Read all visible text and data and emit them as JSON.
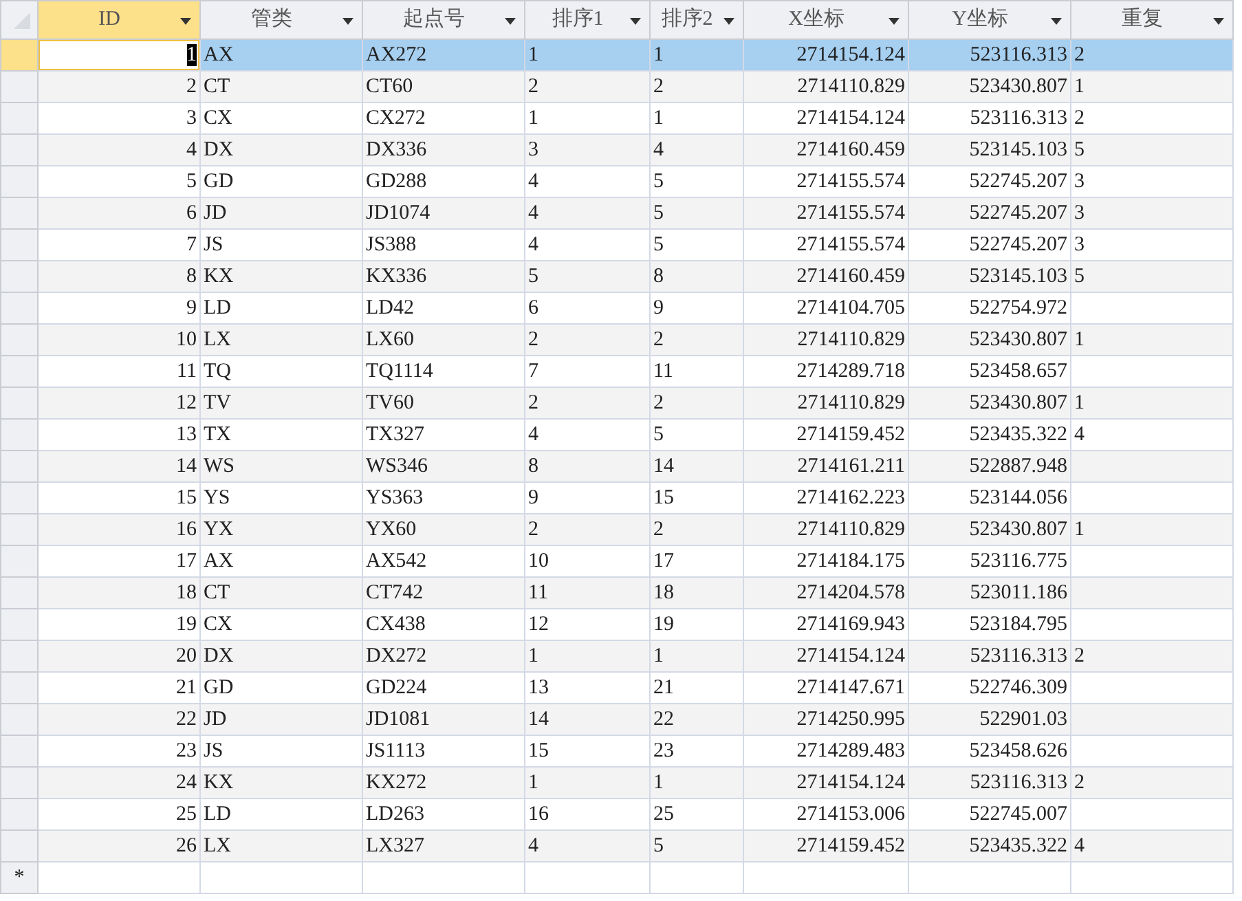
{
  "columns": [
    {
      "label": "ID",
      "selected": true
    },
    {
      "label": "管类",
      "selected": false
    },
    {
      "label": "起点号",
      "selected": false
    },
    {
      "label": "排序1",
      "selected": false
    },
    {
      "label": "排序2",
      "selected": false
    },
    {
      "label": "X坐标",
      "selected": false
    },
    {
      "label": "Y坐标",
      "selected": false
    },
    {
      "label": "重复",
      "selected": false
    }
  ],
  "rows": [
    {
      "selected": true,
      "cells": [
        "1",
        "AX",
        "AX272",
        "1",
        "1",
        "2714154.124",
        "523116.313",
        "2"
      ]
    },
    {
      "selected": false,
      "cells": [
        "2",
        "CT",
        "CT60",
        "2",
        "2",
        "2714110.829",
        "523430.807",
        "1"
      ]
    },
    {
      "selected": false,
      "cells": [
        "3",
        "CX",
        "CX272",
        "1",
        "1",
        "2714154.124",
        "523116.313",
        "2"
      ]
    },
    {
      "selected": false,
      "cells": [
        "4",
        "DX",
        "DX336",
        "3",
        "4",
        "2714160.459",
        "523145.103",
        "5"
      ]
    },
    {
      "selected": false,
      "cells": [
        "5",
        "GD",
        "GD288",
        "4",
        "5",
        "2714155.574",
        "522745.207",
        "3"
      ]
    },
    {
      "selected": false,
      "cells": [
        "6",
        "JD",
        "JD1074",
        "4",
        "5",
        "2714155.574",
        "522745.207",
        "3"
      ]
    },
    {
      "selected": false,
      "cells": [
        "7",
        "JS",
        "JS388",
        "4",
        "5",
        "2714155.574",
        "522745.207",
        "3"
      ]
    },
    {
      "selected": false,
      "cells": [
        "8",
        "KX",
        "KX336",
        "5",
        "8",
        "2714160.459",
        "523145.103",
        "5"
      ]
    },
    {
      "selected": false,
      "cells": [
        "9",
        "LD",
        "LD42",
        "6",
        "9",
        "2714104.705",
        "522754.972",
        ""
      ]
    },
    {
      "selected": false,
      "cells": [
        "10",
        "LX",
        "LX60",
        "2",
        "2",
        "2714110.829",
        "523430.807",
        "1"
      ]
    },
    {
      "selected": false,
      "cells": [
        "11",
        "TQ",
        "TQ1114",
        "7",
        "11",
        "2714289.718",
        "523458.657",
        ""
      ]
    },
    {
      "selected": false,
      "cells": [
        "12",
        "TV",
        "TV60",
        "2",
        "2",
        "2714110.829",
        "523430.807",
        "1"
      ]
    },
    {
      "selected": false,
      "cells": [
        "13",
        "TX",
        "TX327",
        "4",
        "5",
        "2714159.452",
        "523435.322",
        "4"
      ]
    },
    {
      "selected": false,
      "cells": [
        "14",
        "WS",
        "WS346",
        "8",
        "14",
        "2714161.211",
        "522887.948",
        ""
      ]
    },
    {
      "selected": false,
      "cells": [
        "15",
        "YS",
        "YS363",
        "9",
        "15",
        "2714162.223",
        "523144.056",
        ""
      ]
    },
    {
      "selected": false,
      "cells": [
        "16",
        "YX",
        "YX60",
        "2",
        "2",
        "2714110.829",
        "523430.807",
        "1"
      ]
    },
    {
      "selected": false,
      "cells": [
        "17",
        "AX",
        "AX542",
        "10",
        "17",
        "2714184.175",
        "523116.775",
        ""
      ]
    },
    {
      "selected": false,
      "cells": [
        "18",
        "CT",
        "CT742",
        "11",
        "18",
        "2714204.578",
        "523011.186",
        ""
      ]
    },
    {
      "selected": false,
      "cells": [
        "19",
        "CX",
        "CX438",
        "12",
        "19",
        "2714169.943",
        "523184.795",
        ""
      ]
    },
    {
      "selected": false,
      "cells": [
        "20",
        "DX",
        "DX272",
        "1",
        "1",
        "2714154.124",
        "523116.313",
        "2"
      ]
    },
    {
      "selected": false,
      "cells": [
        "21",
        "GD",
        "GD224",
        "13",
        "21",
        "2714147.671",
        "522746.309",
        ""
      ]
    },
    {
      "selected": false,
      "cells": [
        "22",
        "JD",
        "JD1081",
        "14",
        "22",
        "2714250.995",
        "522901.03",
        ""
      ]
    },
    {
      "selected": false,
      "cells": [
        "23",
        "JS",
        "JS1113",
        "15",
        "23",
        "2714289.483",
        "523458.626",
        ""
      ]
    },
    {
      "selected": false,
      "cells": [
        "24",
        "KX",
        "KX272",
        "1",
        "1",
        "2714154.124",
        "523116.313",
        "2"
      ]
    },
    {
      "selected": false,
      "cells": [
        "25",
        "LD",
        "LD263",
        "16",
        "25",
        "2714153.006",
        "522745.007",
        ""
      ]
    },
    {
      "selected": false,
      "cells": [
        "26",
        "LX",
        "LX327",
        "4",
        "5",
        "2714159.452",
        "523435.322",
        "4"
      ]
    }
  ],
  "new_row_marker": "*"
}
